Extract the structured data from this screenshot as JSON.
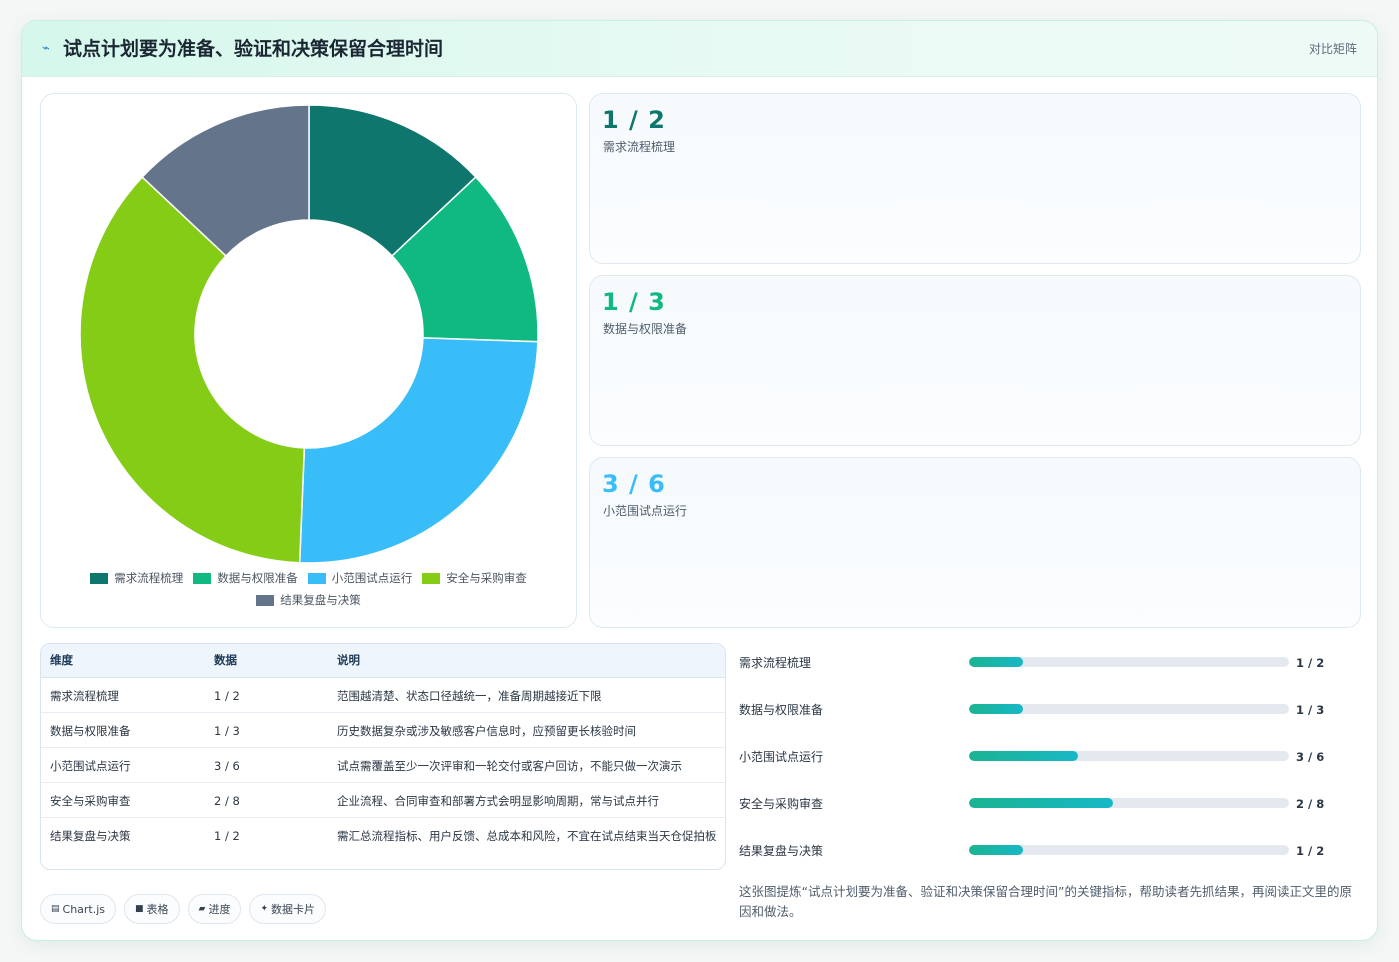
{
  "header": {
    "title": "试点计划要为准备、验证和决策保留合理时间",
    "tag": "对比矩阵"
  },
  "chart_data": {
    "type": "doughnut",
    "categories": [
      "需求流程梳理",
      "数据与权限准备",
      "小范围试点运行",
      "安全与采购审查",
      "结果复盘与决策"
    ],
    "values": [
      0.5,
      0.4833,
      0.9667,
      1.4,
      0.5
    ],
    "colors": [
      "#0f766e",
      "#10b981",
      "#38bdf8",
      "#84cc16",
      "#64748b"
    ],
    "legend_position": "bottom"
  },
  "kpis": [
    {
      "value": "1 / 2",
      "label": "需求流程梳理",
      "color": "#0f766e"
    },
    {
      "value": "1 / 3",
      "label": "数据与权限准备",
      "color": "#10b981"
    },
    {
      "value": "3 / 6",
      "label": "小范围试点运行",
      "color": "#38bdf8"
    }
  ],
  "table": {
    "headers": [
      "维度",
      "数据",
      "说明"
    ],
    "rows": [
      [
        "需求流程梳理",
        "1 / 2",
        "范围越清楚、状态口径越统一，准备周期越接近下限"
      ],
      [
        "数据与权限准备",
        "1 / 3",
        "历史数据复杂或涉及敏感客户信息时，应预留更长核验时间"
      ],
      [
        "小范围试点运行",
        "3 / 6",
        "试点需覆盖至少一次评审和一轮交付或客户回访，不能只做一次演示"
      ],
      [
        "安全与采购审查",
        "2 / 8",
        "企业流程、合同审查和部署方式会明显影响周期，常与试点并行"
      ],
      [
        "结果复盘与决策",
        "1 / 2",
        "需汇总流程指标、用户反馈、总成本和风险，不宜在试点结束当天仓促拍板"
      ]
    ]
  },
  "progress": [
    {
      "label": "需求流程梳理",
      "value": "1 / 2",
      "fraction": 0.17
    },
    {
      "label": "数据与权限准备",
      "value": "1 / 3",
      "fraction": 0.17
    },
    {
      "label": "小范围试点运行",
      "value": "3 / 6",
      "fraction": 0.34
    },
    {
      "label": "安全与采购审查",
      "value": "2 / 8",
      "fraction": 0.45
    },
    {
      "label": "结果复盘与决策",
      "value": "1 / 2",
      "fraction": 0.17
    }
  ],
  "note": "这张图提炼“试点计划要为准备、验证和决策保留合理时间”的关键指标，帮助读者先抓结果，再阅读正文里的原因和做法。",
  "chips": [
    {
      "icon": "chart-icon",
      "label": "Chart.js"
    },
    {
      "icon": "table-icon",
      "label": "表格"
    },
    {
      "icon": "progress-icon",
      "label": "进度"
    },
    {
      "icon": "sparkle-icon",
      "label": "数据卡片"
    }
  ]
}
